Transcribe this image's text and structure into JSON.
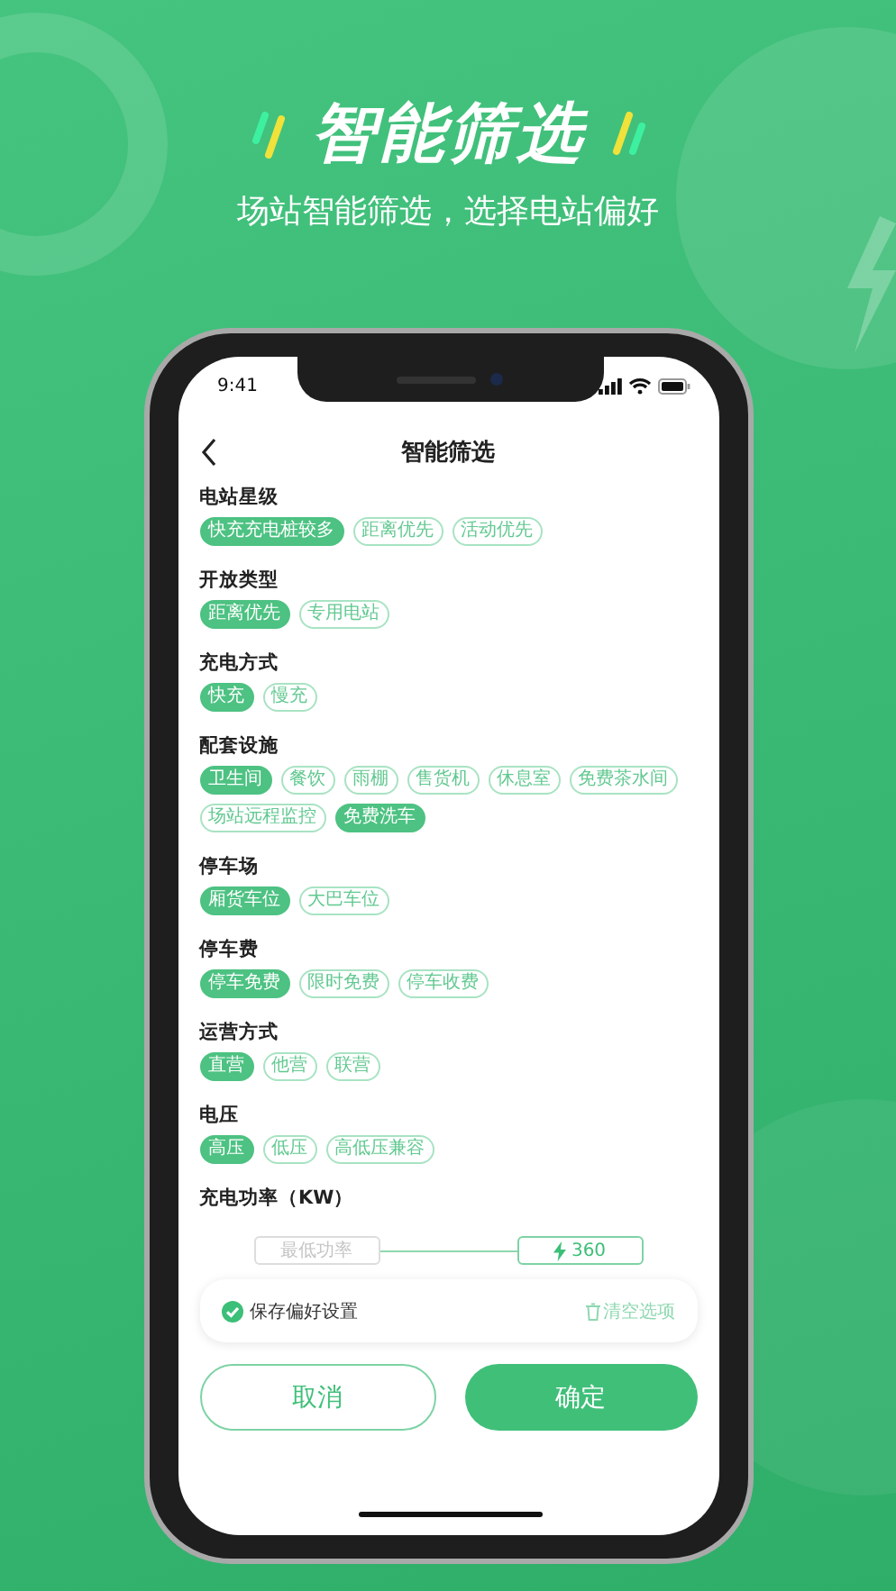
{
  "headline": "智能筛选",
  "subtitle": "场站智能筛选，选择电站偏好",
  "phone": {
    "status_bar": {
      "time": "9:41"
    },
    "nav": {
      "title": "智能筛选"
    },
    "sections": [
      {
        "title": "电站星级",
        "options": [
          {
            "label": "快充充电桩较多",
            "selected": true
          },
          {
            "label": "距离优先",
            "selected": false
          },
          {
            "label": "活动优先",
            "selected": false
          }
        ]
      },
      {
        "title": "开放类型",
        "options": [
          {
            "label": "距离优先",
            "selected": true
          },
          {
            "label": "专用电站",
            "selected": false
          }
        ]
      },
      {
        "title": "充电方式",
        "options": [
          {
            "label": "快充",
            "selected": true
          },
          {
            "label": "慢充",
            "selected": false
          }
        ]
      },
      {
        "title": "配套设施",
        "options": [
          {
            "label": "卫生间",
            "selected": true
          },
          {
            "label": "餐饮",
            "selected": false
          },
          {
            "label": "雨棚",
            "selected": false
          },
          {
            "label": "售货机",
            "selected": false
          },
          {
            "label": "休息室",
            "selected": false
          },
          {
            "label": "免费茶水间",
            "selected": false
          },
          {
            "label": "场站远程监控",
            "selected": false
          },
          {
            "label": "免费洗车",
            "selected": true
          }
        ]
      },
      {
        "title": "停车场",
        "options": [
          {
            "label": "厢货车位",
            "selected": true
          },
          {
            "label": "大巴车位",
            "selected": false
          }
        ]
      },
      {
        "title": "停车费",
        "options": [
          {
            "label": "停车免费",
            "selected": true
          },
          {
            "label": "限时免费",
            "selected": false
          },
          {
            "label": "停车收费",
            "selected": false
          }
        ]
      },
      {
        "title": "运营方式",
        "options": [
          {
            "label": "直营",
            "selected": true
          },
          {
            "label": "他营",
            "selected": false
          },
          {
            "label": "联营",
            "selected": false
          }
        ]
      },
      {
        "title": "电压",
        "options": [
          {
            "label": "高压",
            "selected": true
          },
          {
            "label": "低压",
            "selected": false
          },
          {
            "label": "高低压兼容",
            "selected": false
          }
        ]
      }
    ],
    "power": {
      "title": "充电功率（KW）",
      "min": {
        "placeholder": "最低功率"
      },
      "max": {
        "value": "360"
      }
    },
    "save_preference": {
      "label": "保存偏好设置",
      "checked": true
    },
    "clear": "清空选项",
    "buttons": [
      {
        "label": "取消",
        "kind": "secondary"
      },
      {
        "label": "确定",
        "kind": "primary"
      }
    ]
  }
}
